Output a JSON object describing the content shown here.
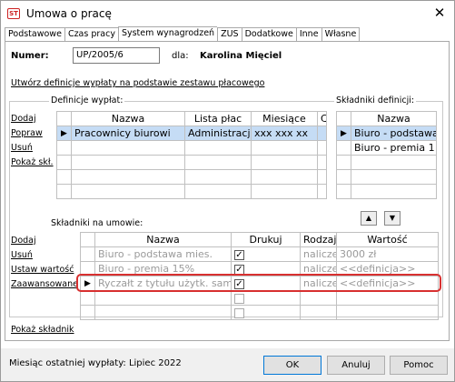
{
  "window": {
    "title": "Umowa o pracę",
    "icon_label": "ST",
    "close_glyph": "✕"
  },
  "tabs": [
    "Podstawowe",
    "Czas pracy",
    "System wynagrodzeń",
    "ZUS",
    "Dodatkowe",
    "Inne",
    "Własne"
  ],
  "form": {
    "numer_label": "Numer:",
    "numer_value": "UP/2005/6",
    "dla_label": "dla:",
    "employee": "Karolina Mięciel"
  },
  "create_link": "Utwórz definicje wypłaty na podstawie zestawu płacowego",
  "definitions": {
    "title": "Definicje wypłat:",
    "actions": [
      "Dodaj",
      "Popraw",
      "Usuń",
      "Pokaż skł."
    ],
    "columns": [
      "Nazwa",
      "Lista płac",
      "Miesiące",
      "C"
    ],
    "rows": [
      {
        "nazwa": "Pracownicy biurowi",
        "lista": "Administracj",
        "miesiace": "xxx xxx xx"
      }
    ]
  },
  "components": {
    "title": "Składniki definicji:",
    "column": "Nazwa",
    "rows": [
      "Biuro - podstawa",
      "Biuro - premia 1"
    ]
  },
  "contract": {
    "title": "Składniki na umowie:",
    "actions": [
      "Dodaj",
      "Usuń",
      "Ustaw wartość",
      "Zaawansowane",
      "Pokaż składnik"
    ],
    "columns": [
      "Nazwa",
      "Drukuj",
      "Rodzaj",
      "Wartość"
    ],
    "rows": [
      {
        "nazwa": "Biuro - podstawa mies.",
        "drukuj": "✓",
        "rodzaj": "naliczen",
        "wartosc": "3000 zł"
      },
      {
        "nazwa": "Biuro - premia 15%",
        "drukuj": "✓",
        "rodzaj": "naliczen",
        "wartosc": "<<definicja>>"
      },
      {
        "nazwa": "Ryczałt z tytułu użytk. sam.",
        "drukuj": "✓",
        "rodzaj": "naliczen",
        "wartosc": "<<definicja>>"
      }
    ]
  },
  "footer": {
    "status": "Miesiąc ostatniej wypłaty: Lipiec 2022",
    "ok": "OK",
    "cancel": "Anuluj",
    "help": "Pomoc"
  }
}
